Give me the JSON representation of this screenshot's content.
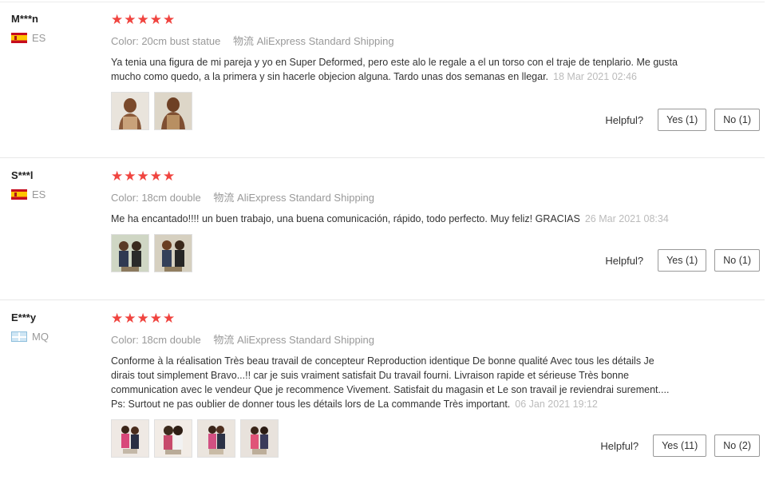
{
  "reviews": [
    {
      "user": "M***n",
      "country": "ES",
      "rating": 5,
      "color_label": "Color:",
      "color_value": "20cm bust statue",
      "shipping_label": "物流",
      "shipping_value": "AliExpress Standard Shipping",
      "text": "Ya tenia una figura de mi pareja y yo en Super Deformed, pero este alo le regale a el un torso con el traje de tenplario. Me gusta mucho como quedo, a la primera y sin hacerle objecion alguna. Tardo unas dos semanas en llegar.",
      "date": "18 Mar 2021 02:46",
      "helpful_label": "Helpful?",
      "yes": "Yes (1)",
      "no": "No (1)"
    },
    {
      "user": "S***l",
      "country": "ES",
      "rating": 5,
      "color_label": "Color:",
      "color_value": "18cm double",
      "shipping_label": "物流",
      "shipping_value": "AliExpress Standard Shipping",
      "text": "Me ha encantado!!!! un buen trabajo, una buena comunicación, rápido, todo perfecto. Muy feliz! GRACIAS",
      "date": "26 Mar 2021 08:34",
      "helpful_label": "Helpful?",
      "yes": "Yes (1)",
      "no": "No (1)"
    },
    {
      "user": "E***y",
      "country": "MQ",
      "rating": 5,
      "color_label": "Color:",
      "color_value": "18cm double",
      "shipping_label": "物流",
      "shipping_value": "AliExpress Standard Shipping",
      "text": "Conforme à la réalisation Très beau travail de concepteur Reproduction identique De bonne qualité Avec tous les détails Je dirais tout simplement Bravo...!! car je suis vraiment satisfait Du travail fourni. Livraison rapide et sérieuse Très bonne communication avec le vendeur Que je recommence Vivement. Satisfait du magasin et Le son travail je reviendrai surement.... Ps: Surtout ne pas oublier de donner tous les détails lors de La commande Très important.",
      "date": "06 Jan 2021 19:12",
      "helpful_label": "Helpful?",
      "yes": "Yes (11)",
      "no": "No (2)"
    }
  ],
  "star_glyph": "★",
  "colors": {
    "star": "#f0443f",
    "meta": "#999999",
    "date": "#bbbbbb",
    "divider": "#e8e8e8"
  },
  "icons": {
    "flag_es": "spain-flag-icon",
    "flag_mq": "martinique-flag-icon",
    "star": "star-icon"
  }
}
